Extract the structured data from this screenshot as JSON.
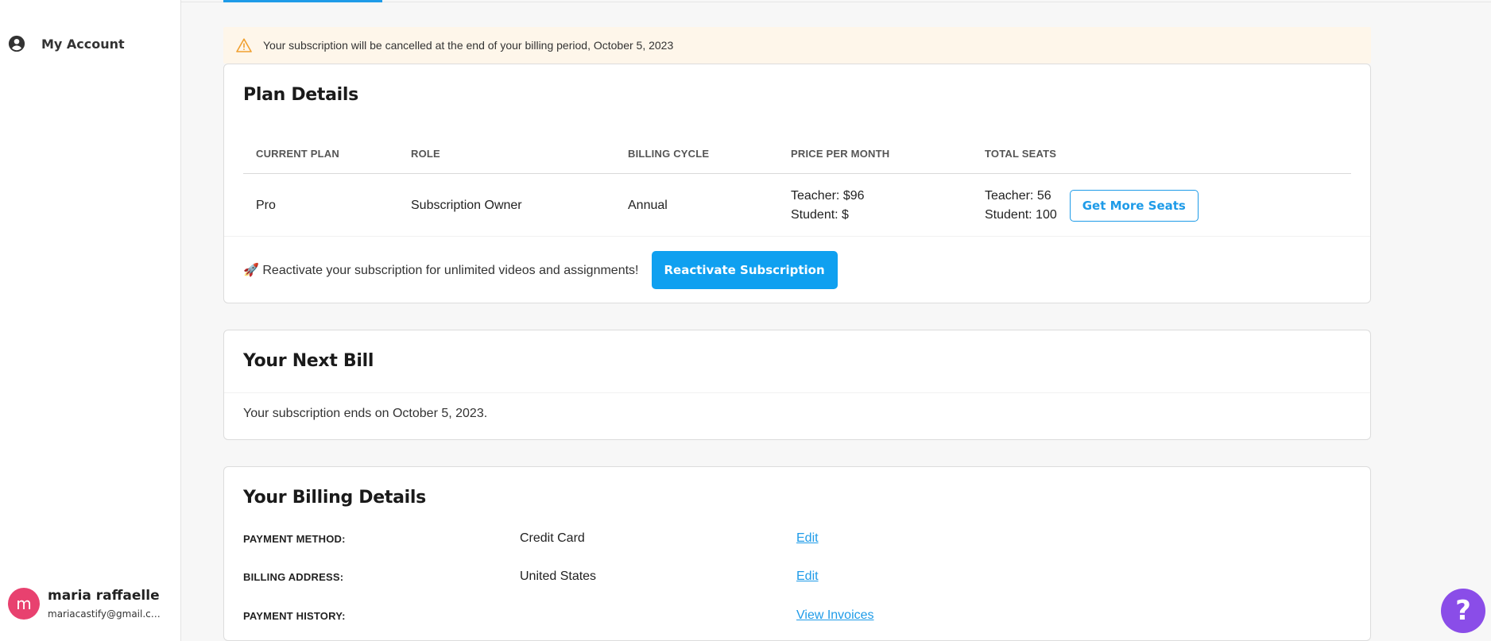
{
  "sidebar": {
    "account_label": "My Account",
    "user": {
      "avatar_initial": "m",
      "name": "maria raffaelle",
      "email": "mariacastify@gmail.co..."
    }
  },
  "alert": {
    "icon": "warning-icon",
    "message": "Your subscription will be cancelled at the end of your billing period, October 5, 2023"
  },
  "plan_details": {
    "title": "Plan Details",
    "headers": {
      "current_plan": "CURRENT PLAN",
      "role": "ROLE",
      "billing_cycle": "BILLING CYCLE",
      "price_per_month": "PRICE PER MONTH",
      "total_seats": "TOTAL SEATS"
    },
    "row": {
      "current_plan": "Pro",
      "role": "Subscription Owner",
      "billing_cycle": "Annual",
      "price_teacher": "Teacher: $96",
      "price_student": "Student: $",
      "seats_teacher": "Teacher: 56",
      "seats_student": "Student: 100"
    },
    "get_more_seats_label": "Get More Seats",
    "reactivate_message": "🚀 Reactivate your subscription for unlimited videos and assignments!",
    "reactivate_button_label": "Reactivate Subscription"
  },
  "next_bill": {
    "title": "Your Next Bill",
    "text": "Your subscription ends on October 5, 2023."
  },
  "billing_details": {
    "title": "Your Billing Details",
    "rows": [
      {
        "label": "PAYMENT METHOD:",
        "value": "Credit Card",
        "action": "Edit"
      },
      {
        "label": "BILLING ADDRESS:",
        "value": "United States",
        "action": "Edit"
      },
      {
        "label": "PAYMENT HISTORY:",
        "value": "",
        "action": "View Invoices"
      }
    ]
  },
  "help": {
    "label": "?"
  },
  "colors": {
    "accent": "#1e9be8",
    "primary_button": "#0fa0f0",
    "alert_bg": "#fef6ea",
    "help": "#8a4de8",
    "avatar": "#e8416f"
  }
}
